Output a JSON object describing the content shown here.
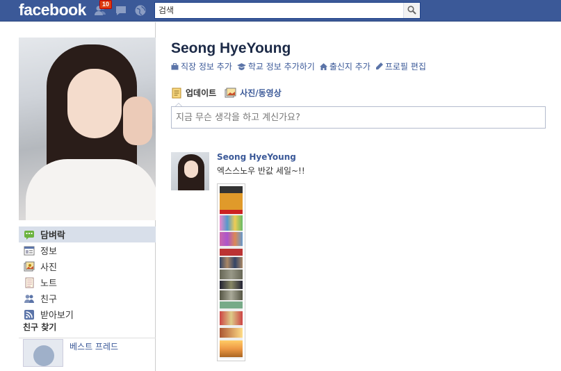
{
  "topbar": {
    "logo": "facebook",
    "notification_count": "10",
    "search_placeholder": "검색",
    "icons": [
      "friends-icon",
      "messages-icon",
      "notifications-globe-icon",
      "search-icon"
    ]
  },
  "profile": {
    "name": "Seong HyeYoung",
    "info_links": [
      {
        "icon": "briefcase-icon",
        "label": "직장 정보 추가"
      },
      {
        "icon": "school-icon",
        "label": "학교 정보 추가하기"
      },
      {
        "icon": "house-icon",
        "label": "출신지 추가"
      },
      {
        "icon": "pencil-icon",
        "label": "프로필 편집"
      }
    ]
  },
  "sidebar": {
    "items": [
      {
        "icon": "wall-icon",
        "label": "담벼락",
        "active": true
      },
      {
        "icon": "info-icon",
        "label": "정보"
      },
      {
        "icon": "photos-icon",
        "label": "사진"
      },
      {
        "icon": "notes-icon",
        "label": "노트"
      },
      {
        "icon": "friends-icon",
        "label": "친구"
      },
      {
        "icon": "rss-icon",
        "label": "받아보기"
      }
    ],
    "find_friends_title": "친구 찾기",
    "find_friends_item": "베스트 프레드"
  },
  "composer": {
    "tabs": [
      {
        "icon": "status-icon",
        "label": "업데이트"
      },
      {
        "icon": "photo-video-icon",
        "label": "사진/동영상"
      }
    ],
    "placeholder": "지금 무슨 생각을 하고 계신가요?"
  },
  "story": {
    "author": "Seong HyeYoung",
    "text": "엑스스노우 반값 세일~!!"
  },
  "colors": {
    "brand": "#3b5998",
    "active_nav": "#d8dfea",
    "badge": "#dd3c10"
  }
}
